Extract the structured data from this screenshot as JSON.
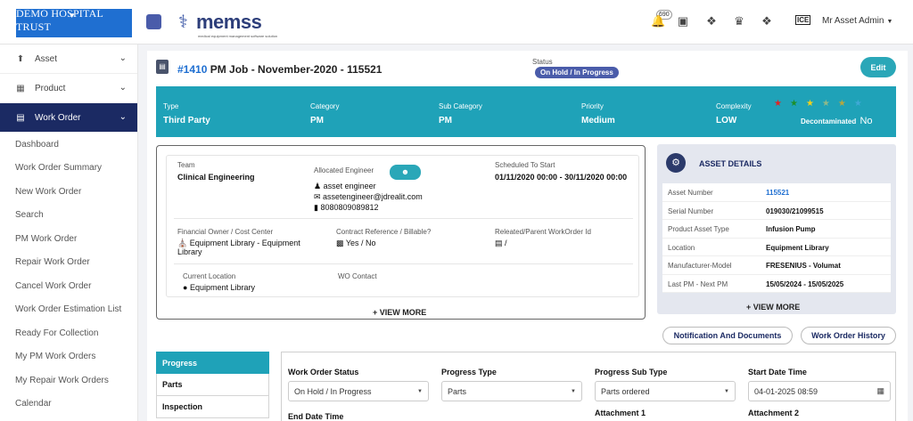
{
  "header": {
    "brand": "DEMO HOSPITAL TRUST",
    "logo_text": "memss",
    "logo_sub": "medical equipment management software solution",
    "notif_count": "690",
    "lab_logo": "ICE",
    "user_name": "Mr Asset Admin"
  },
  "sidebar": {
    "asset": "Asset",
    "product": "Product",
    "work_order": "Work Order",
    "items": [
      "Dashboard",
      "Work Order Summary",
      "New Work Order",
      "Search",
      "PM Work Order",
      "Repair Work Order",
      "Cancel Work Order",
      "Work Order Estimation List",
      "Ready For Collection",
      "My PM Work Orders",
      "My Repair Work Orders",
      "Calendar"
    ]
  },
  "job": {
    "id": "#1410",
    "title": "PM Job - November-2020 - 115521",
    "status_label": "Status",
    "status": "On Hold / In Progress",
    "edit": "Edit"
  },
  "summary": {
    "type_label": "Type",
    "type": "Third Party",
    "category_label": "Category",
    "category": "PM",
    "subcategory_label": "Sub Category",
    "subcategory": "PM",
    "priority_label": "Priority",
    "priority": "Medium",
    "complexity_label": "Complexity",
    "complexity": "LOW",
    "decon_label": "Decontaminated",
    "decon_value": "No",
    "star_colors": [
      "#e02424",
      "#1d8f2a",
      "#f2d21b",
      "#8fb98a",
      "#b5a740",
      "#3fa9d6"
    ]
  },
  "details": {
    "team_label": "Team",
    "team": "Clinical Engineering",
    "engineer_label": "Allocated Engineer",
    "engineer_name": "asset engineer",
    "engineer_email": "assetengineer@jdrealit.com",
    "engineer_phone": "8080809089812",
    "schedule_label": "Scheduled To Start",
    "schedule": "01/11/2020 00:00 - 30/11/2020 00:00",
    "fin_label": "Financial Owner / Cost Center",
    "fin_value": "Equipment Library - Equipment Library",
    "contract_label": "Contract Reference / Billable?",
    "contract_value": "Yes / No",
    "related_label": "Releated/Parent WorkOrder Id",
    "related_value": "/",
    "location_label": "Current Location",
    "location": "Equipment Library",
    "wo_contact_label": "WO Contact",
    "view_more": "+ VIEW MORE"
  },
  "asset": {
    "title": "ASSET DETAILS",
    "rows": [
      {
        "k": "Asset Number",
        "v": "115521"
      },
      {
        "k": "Serial Number",
        "v": "019030/21099515"
      },
      {
        "k": "Product Asset Type",
        "v": "Infusion Pump"
      },
      {
        "k": "Location",
        "v": "Equipment Library"
      },
      {
        "k": "Manufacturer-Model",
        "v": "FRESENIUS - Volumat"
      },
      {
        "k": "Last PM - Next PM",
        "v": "15/05/2024 - 15/05/2025"
      }
    ],
    "view_more": "+ VIEW MORE"
  },
  "actions": {
    "notif_docs": "Notification And Documents",
    "history": "Work Order History"
  },
  "tabs": [
    "Progress",
    "Parts",
    "Inspection"
  ],
  "form": {
    "status_label": "Work Order Status",
    "status_value": "On Hold / In Progress",
    "ptype_label": "Progress Type",
    "ptype_value": "Parts",
    "psub_label": "Progress Sub Type",
    "psub_value": "Parts ordered",
    "start_label": "Start Date Time",
    "start_value": "04-01-2025 08:59",
    "end_label": "End Date Time",
    "att1_label": "Attachment 1",
    "att2_label": "Attachment 2"
  }
}
